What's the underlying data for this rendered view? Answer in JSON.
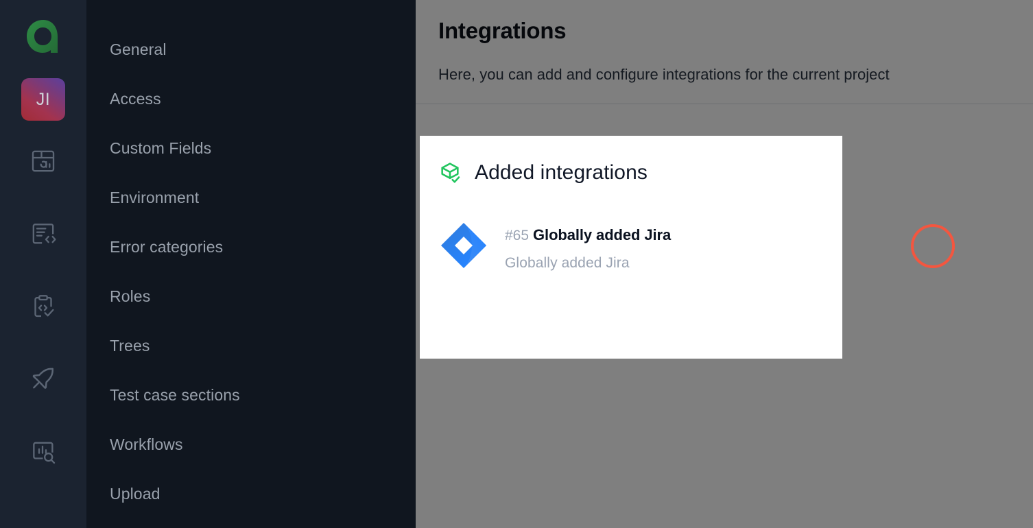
{
  "rail": {
    "brand": {
      "name": "allure-logo",
      "color": "#2f8f46"
    },
    "project_avatar": {
      "initials": "JI",
      "gradient_from": "#5a3f9e",
      "gradient_to": "#a22c36"
    },
    "icons": [
      {
        "name": "dashboard-icon",
        "label": "Dashboards"
      },
      {
        "name": "document-code-icon",
        "label": "Test results"
      },
      {
        "name": "clipboard-check-icon",
        "label": "Test cases"
      },
      {
        "name": "rocket-icon",
        "label": "Launches"
      },
      {
        "name": "report-search-icon",
        "label": "Analytics"
      }
    ]
  },
  "settings_nav": {
    "items": [
      {
        "label": "General"
      },
      {
        "label": "Access"
      },
      {
        "label": "Custom Fields"
      },
      {
        "label": "Environment"
      },
      {
        "label": "Error categories"
      },
      {
        "label": "Roles"
      },
      {
        "label": "Trees"
      },
      {
        "label": "Test case sections"
      },
      {
        "label": "Workflows"
      },
      {
        "label": "Upload"
      }
    ]
  },
  "page": {
    "title": "Integrations",
    "subtitle": "Here, you can add and configure integrations for the current project"
  },
  "modal": {
    "heading": "Added integrations",
    "heading_icon": "cube-check-icon",
    "accent_color": "#22c55e",
    "integrations": [
      {
        "logo": "jira-icon",
        "id": "#65",
        "name": "Globally added Jira",
        "description": "Globally added Jira"
      }
    ]
  },
  "annotation": {
    "name": "highlight-ring",
    "color": "#f4563f",
    "targets": "#65"
  }
}
